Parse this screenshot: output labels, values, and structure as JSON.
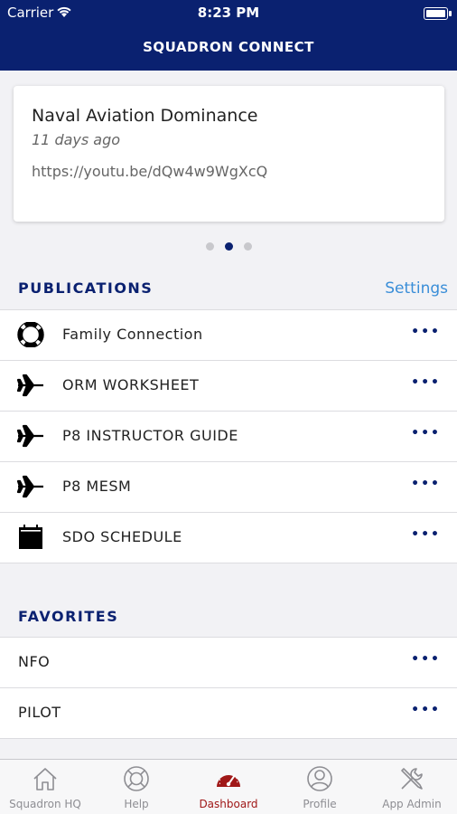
{
  "status": {
    "carrier": "Carrier",
    "time": "8:23 PM"
  },
  "header": {
    "title": "SQUADRON CONNECT"
  },
  "card": {
    "title": "Naval Aviation Dominance",
    "date": "11 days ago",
    "url": "https://youtu.be/dQw4w9WgXcQ"
  },
  "pager": {
    "count": 3,
    "active_index": 1
  },
  "publications": {
    "heading": "PUBLICATIONS",
    "settings_label": "Settings",
    "items": [
      {
        "icon": "lifebuoy-icon",
        "label": "Family Connection"
      },
      {
        "icon": "airplane-icon",
        "label": "ORM WORKSHEET"
      },
      {
        "icon": "airplane-icon",
        "label": "P8 INSTRUCTOR GUIDE"
      },
      {
        "icon": "airplane-icon",
        "label": "P8 MESM"
      },
      {
        "icon": "calendar-icon",
        "label": "SDO SCHEDULE"
      }
    ]
  },
  "favorites": {
    "heading": "FAVORITES",
    "items": [
      {
        "label": "NFO"
      },
      {
        "label": "PILOT"
      }
    ]
  },
  "more_label": "•••",
  "tabs": [
    {
      "icon": "home-icon",
      "label": "Squadron HQ"
    },
    {
      "icon": "lifebuoy-icon",
      "label": "Help"
    },
    {
      "icon": "speedometer-icon",
      "label": "Dashboard",
      "active": true
    },
    {
      "icon": "profile-icon",
      "label": "Profile"
    },
    {
      "icon": "tools-icon",
      "label": "App Admin"
    }
  ],
  "colors": {
    "navy": "#0a2170",
    "accent_link": "#3a8ed8",
    "active_tab": "#a01818"
  }
}
